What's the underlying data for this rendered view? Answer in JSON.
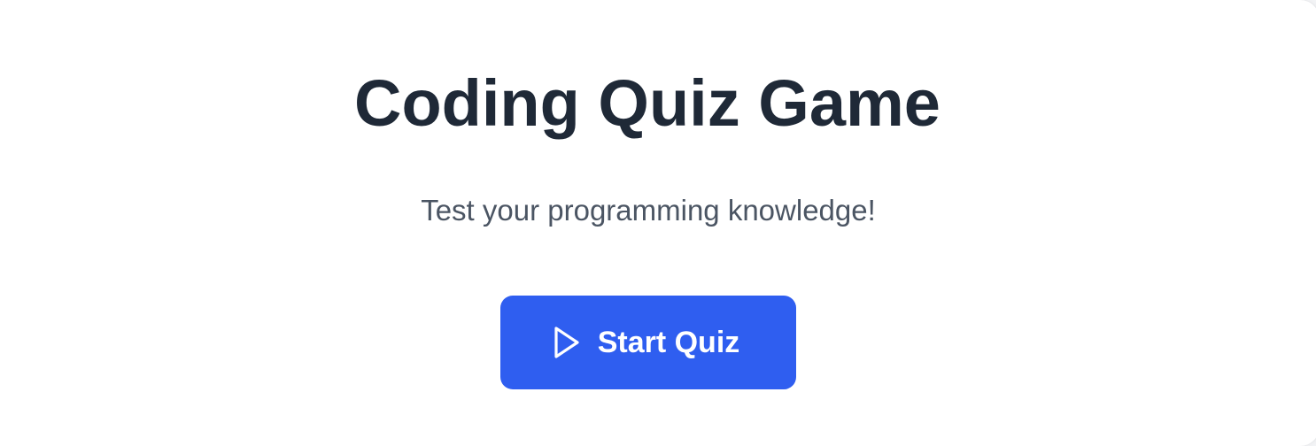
{
  "page": {
    "title": "Coding Quiz Game",
    "subtitle": "Test your programming knowledge!"
  },
  "actions": {
    "start_label": "Start Quiz",
    "start_icon": "play-icon"
  },
  "colors": {
    "background": "#f3f4f6",
    "card": "#ffffff",
    "title": "#1f2937",
    "subtitle": "#4b5563",
    "primary": "#2f5ef0"
  }
}
